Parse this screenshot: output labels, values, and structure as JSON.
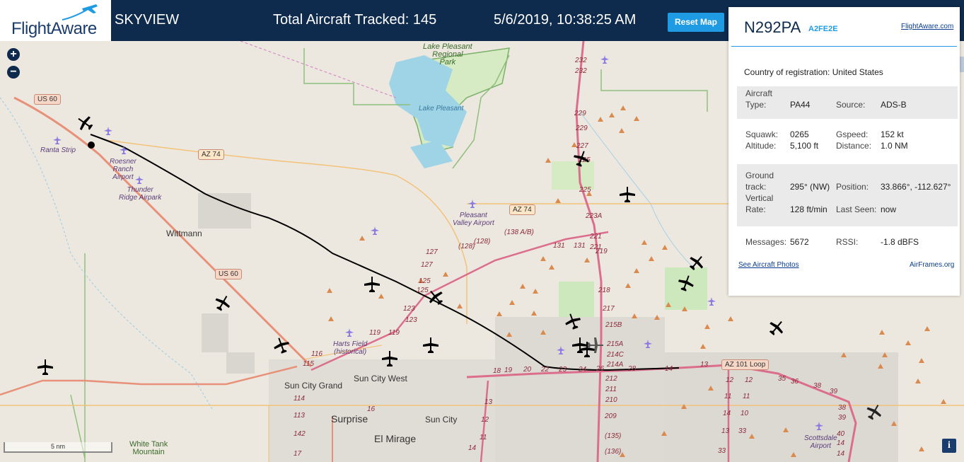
{
  "header": {
    "logo_text": "FlightAware",
    "site_name": "SKYVIEW",
    "tracked": "Total Aircraft Tracked: 145",
    "datetime": "5/6/2019, 10:38:25 AM",
    "reset_label": "Reset Map"
  },
  "map": {
    "zoom_in": "+",
    "zoom_out": "−",
    "scale_label": "5 nm",
    "info_label": "i",
    "places": {
      "lake_park": "Lake Pleasant\nRegional\nPark",
      "lake": "Lake Pleasant",
      "ranta": "Ranta Strip",
      "roesner": "Roesner\nRanch\nAirport",
      "thunder": "Thunder\nRidge Airpark",
      "pleasant_valley": "Pleasant\nValley Airport",
      "harts": "Harts Field\n(historical)",
      "scottsdale": "Scottsdale\nAirport",
      "wittmann": "Wittmann",
      "sun_city_grand": "Sun City Grand",
      "sun_city_west": "Sun City West",
      "sun_city": "Sun City",
      "surprise": "Surprise",
      "el_mirage": "El Mirage",
      "white_tank": "White Tank\nMountain"
    },
    "shields": {
      "us60_top": "US 60",
      "us60_mid": "US 60",
      "az74_left": "AZ 74",
      "az74_right": "AZ 74",
      "az101": "AZ 101 Loop"
    },
    "routes": [
      "232",
      "232",
      "229",
      "229",
      "227",
      "225",
      "225",
      "223A",
      "221",
      "221",
      "219",
      "218",
      "217",
      "215B",
      "215A",
      "214C",
      "214A",
      "212",
      "211",
      "210",
      "209",
      "(135)",
      "(136)",
      "(138 A/B)",
      "131",
      "131",
      "(128)",
      "(128)",
      "127",
      "127",
      "125",
      "125",
      "123",
      "123",
      "119",
      "119",
      "116",
      "115",
      "114",
      "113",
      "142",
      "17",
      "16",
      "18",
      "19",
      "20",
      "22",
      "23",
      "24",
      "26",
      "28",
      "14",
      "13",
      "12",
      "11",
      "14",
      "13",
      "12",
      "11",
      "10",
      "33",
      "33",
      "35",
      "36",
      "38",
      "39",
      "38",
      "39",
      "40",
      "14",
      "14",
      "13",
      "12",
      "11",
      "14"
    ]
  },
  "panel": {
    "registration": "N292PA",
    "hex": "A2FE2E",
    "fa_link": "FlightAware.com",
    "country_label": "Country of registration:",
    "country_value": "United States",
    "aircraft_type_label": "Aircraft\nType:",
    "aircraft_type_value": "PA44",
    "source_label": "Source:",
    "source_value": "ADS-B",
    "squawk_label": "Squawk:",
    "squawk_value": "0265",
    "gspeed_label": "Gspeed:",
    "gspeed_value": "152 kt",
    "altitude_label": "Altitude:",
    "altitude_value": "5,100 ft",
    "distance_label": "Distance:",
    "distance_value": "1.0 NM",
    "track_label": "Ground\ntrack:",
    "track_value": "295° (NW)",
    "position_label": "Position:",
    "position_value": "33.866°, -112.627°",
    "vrate_label": "Vertical\nRate:",
    "vrate_value": "128 ft/min",
    "lastseen_label": "Last Seen:",
    "lastseen_value": "now",
    "messages_label": "Messages:",
    "messages_value": "5672",
    "rssi_label": "RSSI:",
    "rssi_value": "-1.8 dBFS",
    "photos_link": "See Aircraft Photos",
    "airframes_link": "AirFrames.org"
  },
  "colors": {
    "header_bg": "#0e2a4d",
    "accent": "#1e9be3",
    "map_bg": "#ede8df",
    "highway": "#e8917a",
    "freeway": "#dc6e8d",
    "water": "#9fd3e6",
    "park_border": "#7bb068"
  }
}
